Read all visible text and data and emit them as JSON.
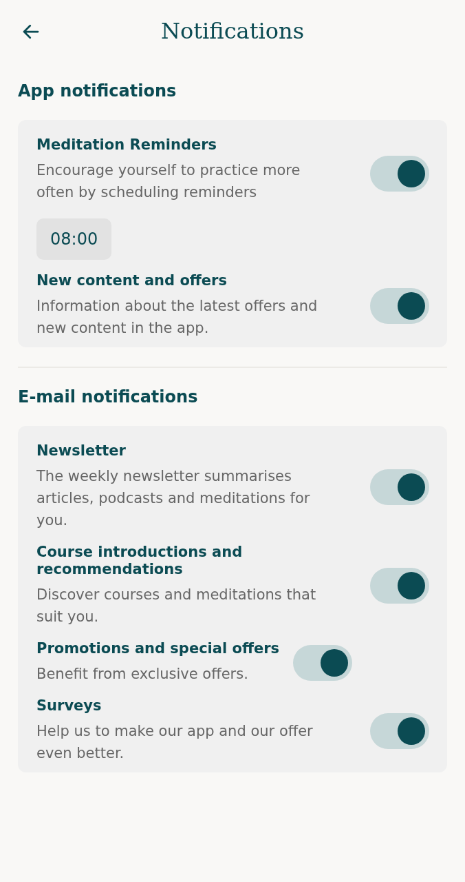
{
  "header": {
    "title": "Notifications"
  },
  "sections": [
    {
      "title": "App notifications",
      "items": [
        {
          "title": "Meditation Reminders",
          "description": "Encourage yourself to practice more often by scheduling reminders",
          "on": true,
          "time": "08:00"
        },
        {
          "title": "New content and offers",
          "description": "Information about the latest offers and new content in the app.",
          "on": true
        }
      ]
    },
    {
      "title": "E-mail notifications",
      "items": [
        {
          "title": "Newsletter",
          "description": "The weekly newsletter summarises articles, podcasts and meditations for you.",
          "on": true
        },
        {
          "title": "Course introductions and recommendations",
          "description": "Discover courses and meditations that suit you.",
          "on": true
        },
        {
          "title": "Promotions and special offers",
          "description": "Benefit from exclusive offers.",
          "on": true
        },
        {
          "title": "Surveys",
          "description": "Help us to make our app and our offer even better.",
          "on": true
        }
      ]
    }
  ]
}
